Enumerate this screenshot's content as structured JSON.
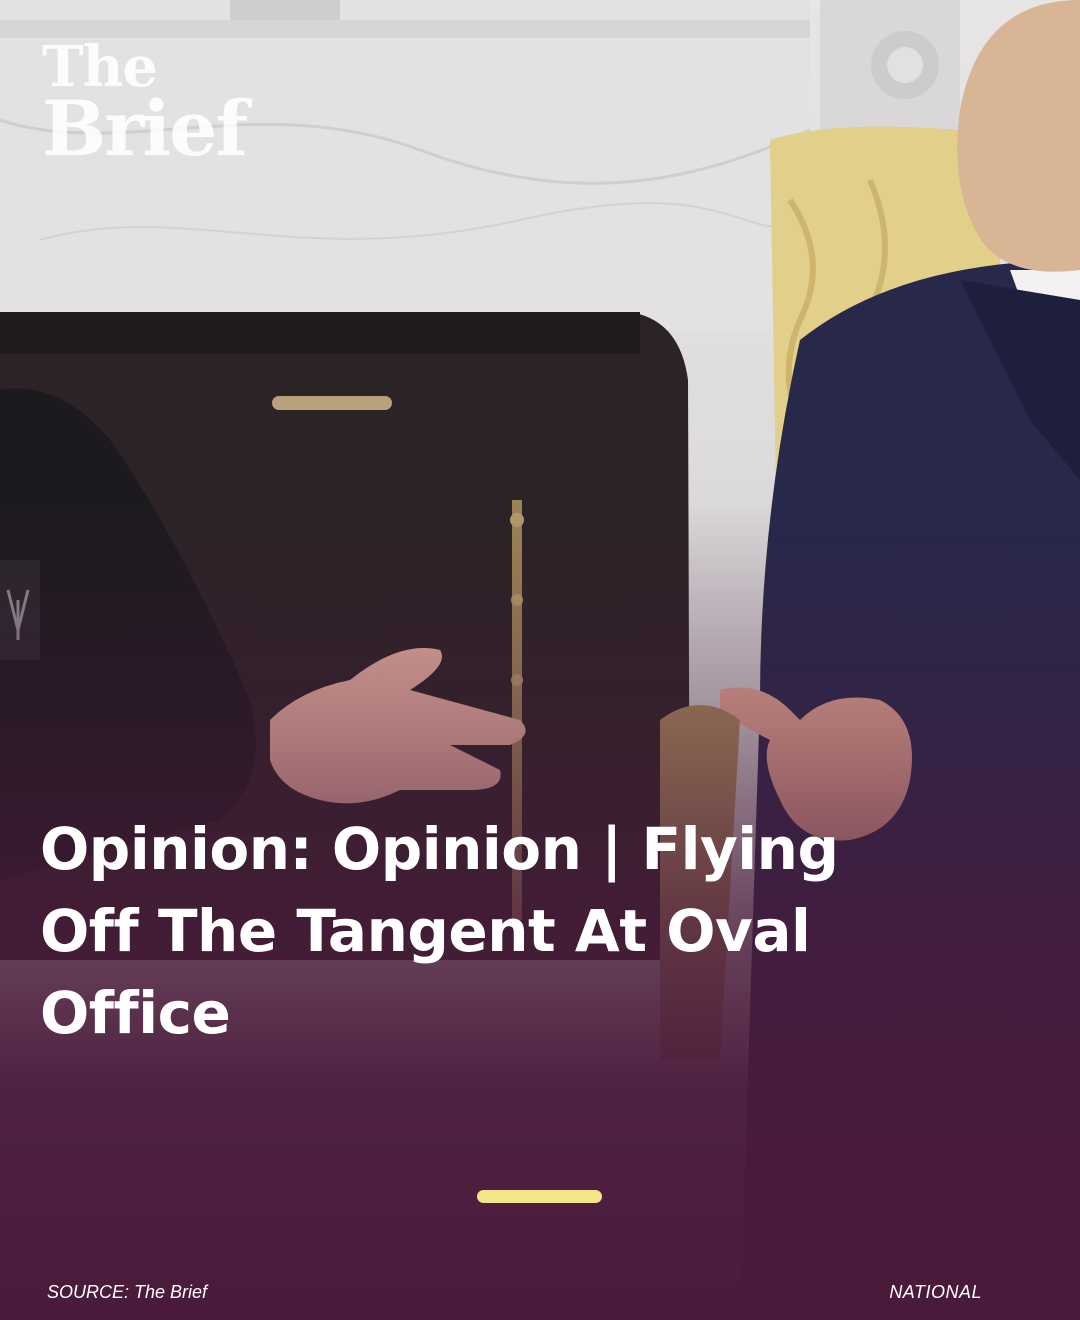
{
  "brand": {
    "line1": "The",
    "line2": "Brief"
  },
  "article": {
    "headline": "Opinion: Opinion | Flying Off The Tangent At Oval Office",
    "source": "SOURCE: The Brief",
    "category": "NATIONAL"
  },
  "colors": {
    "overlay": "#4a1a3b",
    "progress_accent": "#f4e48a",
    "text": "#ffffff"
  }
}
